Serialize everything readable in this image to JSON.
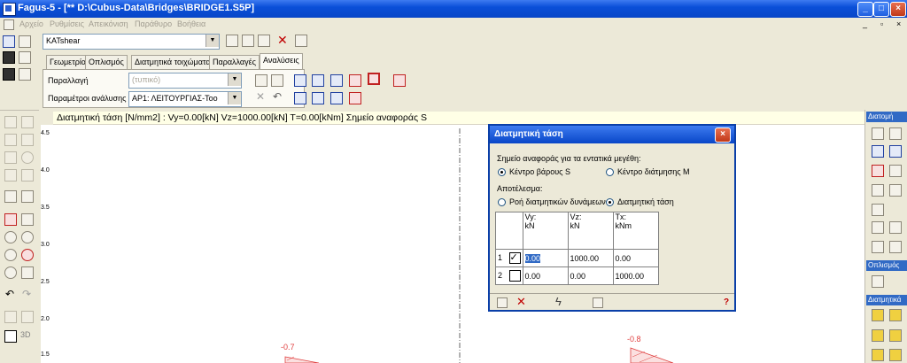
{
  "window": {
    "title": "Fagus-5 - [** D:\\Cubus-Data\\Bridges\\BRIDGE1.S5P]"
  },
  "menu": [
    "Αρχείο",
    "Ρυθμίσεις",
    "Απεικόνιση",
    "Παράθυρο",
    "Βοήθεια"
  ],
  "toolbar": {
    "section_combo": "KATshear"
  },
  "tabs": [
    "Γεωμετρία",
    "Οπλισμός",
    "Διατμητικά τοιχώματα",
    "Παραλλαγές",
    "Αναλύσεις"
  ],
  "analysis": {
    "variant_label": "Παραλλαγή",
    "variant_value": "(τυπικό)",
    "params_label": "Παραμέτροι ανάλυσης",
    "params_value": "ΑΡ1: ΛΕΙΤΟΥΡΓΙΑΣ-Too"
  },
  "status_line": "Διατμητική τάση [N/mm2] : Vy=0.00[kN] Vz=1000.00[kN] T=0.00[kNm] Σημείο αναφοράς S",
  "axis_ticks": [
    "4.5",
    "4.0",
    "3.5",
    "3.0",
    "2.5",
    "2.0",
    "1.5"
  ],
  "canvas_labels": [
    "-0.7",
    "-0.8"
  ],
  "right_panel": {
    "sections": [
      "Διατομή",
      "Οπλισμός",
      "Διατμητικά"
    ]
  },
  "dialog": {
    "title": "Διατμητική τάση",
    "ref_label": "Σημείο αναφοράς για τα εντατικά μεγέθη:",
    "ref_options": [
      "Κέντρο βάρους S",
      "Κέντρο διάτμησης M"
    ],
    "result_label": "Αποτέλεσμα:",
    "result_options": [
      "Ροή διατμητικών δυνάμεων",
      "Διατμητική τάση"
    ],
    "headers": [
      {
        "name": "Vy:",
        "unit": "kN"
      },
      {
        "name": "Vz:",
        "unit": "kN"
      },
      {
        "name": "Tx:",
        "unit": "kNm"
      }
    ],
    "rows": [
      {
        "id": "1",
        "checked": true,
        "vy": "0.00",
        "vz": "1000.00",
        "tx": "0.00"
      },
      {
        "id": "2",
        "checked": false,
        "vy": "0.00",
        "vz": "0.00",
        "tx": "1000.00"
      }
    ],
    "help": "?"
  }
}
